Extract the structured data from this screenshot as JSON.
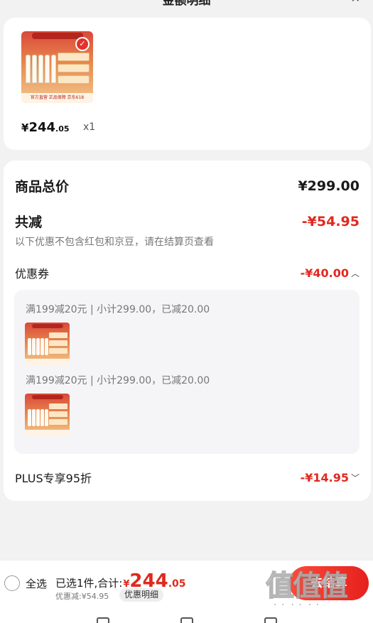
{
  "header": {
    "title": "金额明细",
    "close_icon": "close-icon"
  },
  "product": {
    "price_currency": "¥",
    "price_int": "244",
    "price_dec": ".05",
    "quantity": "x1",
    "thumb_footer": "官方直营  正品保障  京东618",
    "selected_icon": "check-icon"
  },
  "summary": {
    "total_label": "商品总价",
    "total_value": "¥299.00",
    "reduce_label": "共减",
    "reduce_value": "-¥54.95",
    "note": "以下优惠不包含红包和京豆，请在结算页查看",
    "coupon_label": "优惠券",
    "coupon_value": "-¥40.00",
    "coupon_items": [
      {
        "text": "满199减20元 | 小计299.00，已减20.00"
      },
      {
        "text": "满199减20元 | 小计299.00，已减20.00"
      }
    ],
    "plus_label": "PLUS专享95折",
    "plus_value": "-¥14.95"
  },
  "bottom": {
    "select_all": "全选",
    "selected_text": "已选1件,合计:",
    "total_currency": "¥",
    "total_int": "244",
    "total_dec": ".05",
    "discount_text": "优惠减:¥54.95",
    "detail_chip": "优惠明细",
    "checkout": "去结算"
  },
  "watermark": {
    "logo": "值值值",
    "url": "zhizhizhi.com"
  },
  "colors": {
    "accent": "#e0291f",
    "background": "#f2f2f2",
    "card": "#ffffff"
  }
}
